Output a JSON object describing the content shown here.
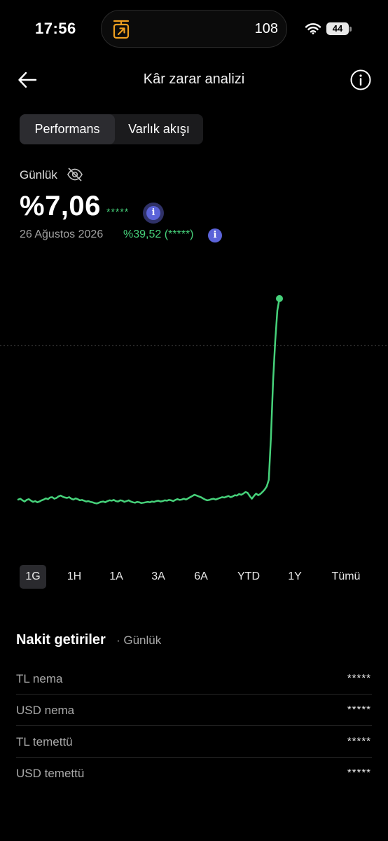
{
  "status_bar": {
    "time": "17:56",
    "island_count": "108",
    "battery": "44"
  },
  "header": {
    "title": "Kâr zarar analizi"
  },
  "tabs": [
    {
      "label": "Performans",
      "active": true
    },
    {
      "label": "Varlık akışı",
      "active": false
    }
  ],
  "summary": {
    "period": "Günlük",
    "value": "%7,06",
    "masked_amount": "*****",
    "date": "26 Ağustos 2026",
    "total_change": "%39,52 (*****)"
  },
  "chart_data": {
    "type": "line",
    "color": "#46d17a",
    "values": [
      40.0,
      40.2,
      39.8,
      39.5,
      39.9,
      40.1,
      39.7,
      39.4,
      39.6,
      39.3,
      39.5,
      39.8,
      40.0,
      40.3,
      40.1,
      40.5,
      40.6,
      40.2,
      40.4,
      40.8,
      41.0,
      40.7,
      40.5,
      40.4,
      40.6,
      40.2,
      40.0,
      40.3,
      40.1,
      39.8,
      39.9,
      39.7,
      39.5,
      39.6,
      39.4,
      39.3,
      39.1,
      39.0,
      39.2,
      39.4,
      39.5,
      39.3,
      39.6,
      39.8,
      39.7,
      39.9,
      39.6,
      39.5,
      39.8,
      39.7,
      39.4,
      39.6,
      39.8,
      39.5,
      39.3,
      39.2,
      39.4,
      39.3,
      39.1,
      39.2,
      39.3,
      39.4,
      39.3,
      39.5,
      39.4,
      39.6,
      39.7,
      39.5,
      39.6,
      39.8,
      39.7,
      39.9,
      39.8,
      39.6,
      39.9,
      40.1,
      39.9,
      40.0,
      40.2,
      40.0,
      40.3,
      40.6,
      40.9,
      41.2,
      41.0,
      40.8,
      40.6,
      40.3,
      40.0,
      39.8,
      39.9,
      40.1,
      40.2,
      40.0,
      40.2,
      40.4,
      40.6,
      40.5,
      40.7,
      40.9,
      40.6,
      40.8,
      41.1,
      41.0,
      41.4,
      41.2,
      41.5,
      41.9,
      41.7,
      40.9,
      40.2,
      40.9,
      41.5,
      41.1,
      41.4,
      41.9,
      42.5,
      43.3,
      45.0,
      56.0,
      70.0,
      80.0,
      88.0,
      91.0
    ],
    "last_value_marker": true,
    "reference_line": "dotted"
  },
  "ranges": [
    {
      "label": "1G",
      "active": true
    },
    {
      "label": "1H",
      "active": false
    },
    {
      "label": "1A",
      "active": false
    },
    {
      "label": "3A",
      "active": false
    },
    {
      "label": "6A",
      "active": false
    },
    {
      "label": "YTD",
      "active": false
    },
    {
      "label": "1Y",
      "active": false
    },
    {
      "label": "Tümü",
      "active": false
    }
  ],
  "cash_returns": {
    "title": "Nakit getiriler",
    "subtitle": "· Günlük",
    "rows": [
      {
        "label": "TL nema",
        "value": "*****"
      },
      {
        "label": "USD nema",
        "value": "*****"
      },
      {
        "label": "TL temettü",
        "value": "*****"
      },
      {
        "label": "USD temettü",
        "value": "*****"
      }
    ]
  },
  "colors": {
    "background": "#000000",
    "positive": "#46d17a",
    "info": "#5b63d9",
    "island_icon": "#f0a020"
  },
  "icons": {
    "back": "arrow-left-icon",
    "info": "info-circle-icon",
    "eye_off": "eye-off-icon",
    "wifi": "wifi-icon",
    "island": "forward-arrow-box-icon"
  }
}
